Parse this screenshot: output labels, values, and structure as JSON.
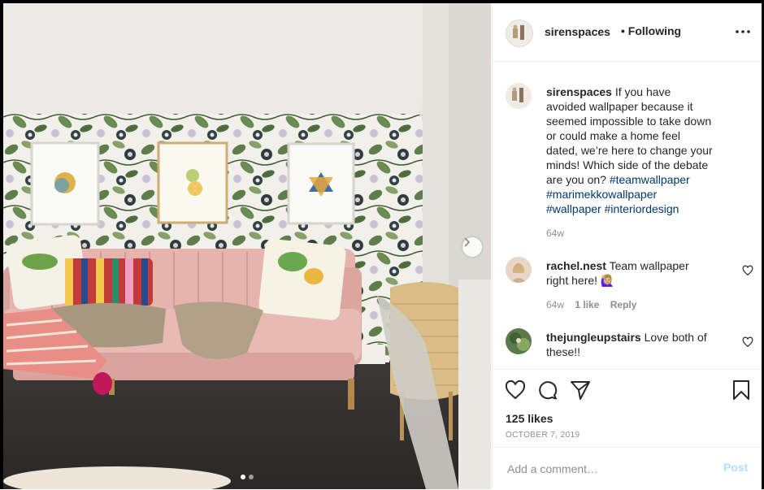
{
  "post": {
    "username": "sirenspaces",
    "following_label": "• Following",
    "more_icon": "more-horizontal-icon",
    "photo_alt": "Living room with pink velvet sofa in front of leafy wallpaper",
    "carousel": {
      "count": 2,
      "current": 1
    }
  },
  "caption": {
    "username": "sirenspaces",
    "text": "If you have avoided wallpaper because it seemed impossible to take down or could make a home feel dated, we’re here to change your minds! Which side of the debate are you on?",
    "hashtags": [
      "#teamwallpaper",
      "#marimekkowallpaper",
      "#wallpaper",
      "#interiordesign"
    ],
    "age": "64w"
  },
  "comments": [
    {
      "username": "rachel.nest",
      "text": "Team wallpaper right here! 🙋🏼‍♀️",
      "age": "64w",
      "likes": "1 like",
      "reply": "Reply"
    },
    {
      "username": "thejungleupstairs",
      "text": "Love both of these!!"
    }
  ],
  "actions": {
    "icons": [
      "heart-icon",
      "comment-icon",
      "share-icon",
      "bookmark-icon"
    ],
    "likes": "125 likes",
    "date": "OCTOBER 7, 2019"
  },
  "add_comment": {
    "placeholder": "Add a comment…",
    "post_label": "Post"
  },
  "colors": {
    "link": "#00376b",
    "post_disabled": "#b2dffc",
    "meta": "#8e8e8e",
    "border": "#efefef",
    "sofa": "#e6b3ad"
  }
}
